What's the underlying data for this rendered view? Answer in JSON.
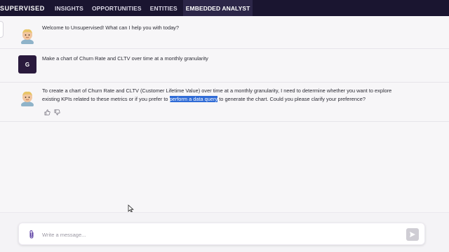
{
  "nav": {
    "brand": "SUPERVISED",
    "tabs": [
      {
        "label": "INSIGHTS",
        "active": false
      },
      {
        "label": "OPPORTUNITIES",
        "active": false
      },
      {
        "label": "ENTITIES",
        "active": false
      },
      {
        "label": "EMBEDDED ANALYST",
        "active": true
      }
    ]
  },
  "messages": [
    {
      "role": "assistant",
      "avatar_icon": "assistant-avatar-icon",
      "text": "Welcome to Unsupervised! What can I help you with today?"
    },
    {
      "role": "user",
      "avatar_initial": "G",
      "text": "Make a chart of Churn Rate and CLTV over time at a monthly granularity"
    },
    {
      "role": "assistant",
      "avatar_icon": "assistant-avatar-icon",
      "text_before": "To create a chart of Churn Rate and CLTV (Customer Lifetime Value) over time at a monthly granularity, I need to determine whether you want to explore existing KPIs related to these metrics or if you prefer to ",
      "text_highlight": "perform a data query",
      "text_after": " to generate the chart. Could you please clarify your preference?",
      "feedback": [
        "thumbs-up-icon",
        "thumbs-down-icon"
      ]
    }
  ],
  "composer": {
    "placeholder": "Write a message...",
    "value": "",
    "attach_icon": "paperclip-icon",
    "send_icon": "send-icon"
  },
  "colors": {
    "nav_bg": "#1a1530",
    "nav_active": "#2c2648",
    "highlight": "#2f6bd6",
    "user_avatar": "#2a1a3d",
    "page_bg": "#f7f6f8"
  }
}
